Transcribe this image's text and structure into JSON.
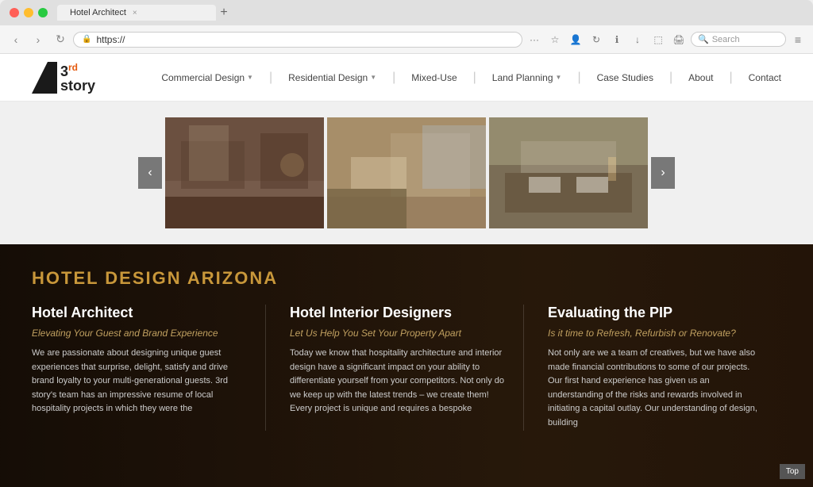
{
  "browser": {
    "tab_title": "Hotel Architect",
    "tab_close": "×",
    "tab_new": "+",
    "url": "https://",
    "back_icon": "‹",
    "forward_icon": "›",
    "refresh_icon": "↻",
    "search_placeholder": "Search",
    "menu_icon": "≡"
  },
  "nav": {
    "logo_num": "3",
    "logo_sup": "rd",
    "logo_word": "story",
    "items": [
      {
        "label": "Commercial Design",
        "has_arrow": true
      },
      {
        "label": "Residential Design",
        "has_arrow": true
      },
      {
        "label": "Mixed-Use",
        "has_arrow": false
      },
      {
        "label": "Land Planning",
        "has_arrow": true
      },
      {
        "label": "Case Studies",
        "has_arrow": false
      },
      {
        "label": "About",
        "has_arrow": false
      },
      {
        "label": "Contact",
        "has_arrow": false
      }
    ]
  },
  "carousel": {
    "prev_label": "‹",
    "next_label": "›"
  },
  "lower": {
    "section_tag": "HOTEL DESIGN ARIZONA",
    "col1": {
      "title": "Hotel Architect",
      "subtitle": "Elevating Your Guest and Brand Experience",
      "text": "We are passionate about designing unique guest experiences that surprise, delight, satisfy and drive brand loyalty to your multi-generational guests.\n\n3rd story's team has an impressive resume of local hospitality projects in which they were the"
    },
    "col2": {
      "title": "Hotel Interior Designers",
      "subtitle": "Let Us Help You Set Your Property Apart",
      "text": "Today we know that hospitality architecture and interior design have a significant impact on your ability to differentiate yourself from your competitors. Not only do we keep up with the latest trends – we create them!\n\nEvery project is unique and requires a bespoke"
    },
    "col3": {
      "title": "Evaluating the PIP",
      "subtitle": "Is it time to Refresh, Refurbish or Renovate?",
      "text": "Not only are we a team of creatives, but we have also made financial contributions to some of our projects. Our first hand experience has given us an understanding of the risks and rewards involved in initiating a capital outlay.\n\nOur understanding of design, building"
    },
    "top_btn": "Top"
  }
}
